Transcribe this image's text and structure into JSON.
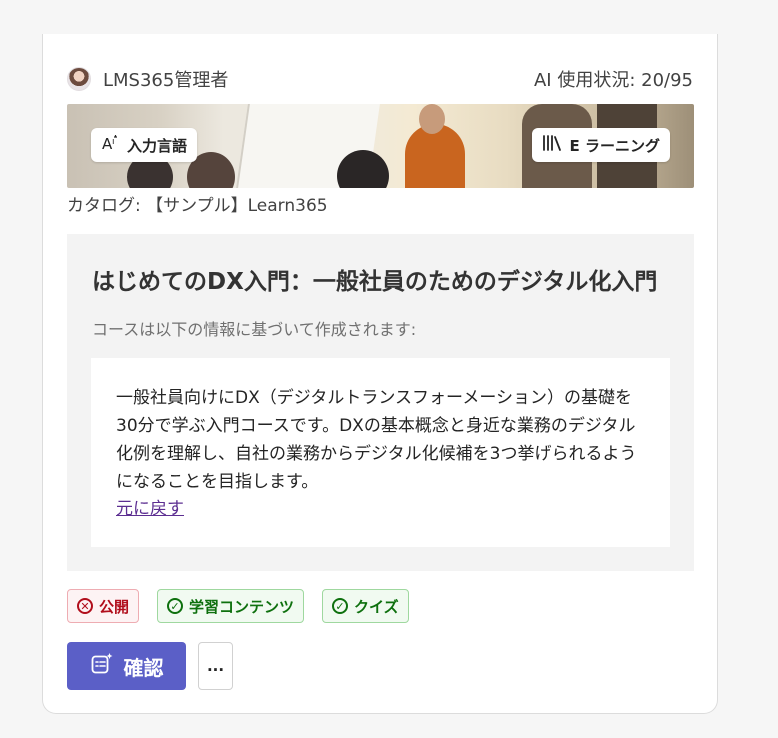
{
  "header": {
    "owner_name": "LMS365管理者",
    "ai_usage": "AI 使用状況: 20/95"
  },
  "banner": {
    "input_language_label": "入力言語",
    "course_type_label": "E ラーニング",
    "input_language_icon": "translate-icon",
    "course_type_icon": "library-icon"
  },
  "catalog": "カタログ: 【サンプル】Learn365",
  "course": {
    "title": "はじめてのDX入門：一般社員のためのデジタル化入門",
    "basis_text": "コースは以下の情報に基づいて作成されます:",
    "description": "一般社員向けにDX（デジタルトランスフォーメーション）の基礎を30分で学ぶ入門コースです。DXの基本概念と身近な業務のデジタル化例を理解し、自社の業務からデジタル化候補を3つ挙げられるようになることを目指します。",
    "revert_link": "元に戻す"
  },
  "tags": [
    {
      "label": "公開",
      "status": "excluded",
      "icon": "x-circle-icon",
      "color": "#b10e1c"
    },
    {
      "label": "学習コンテンツ",
      "status": "included",
      "icon": "check-circle-icon",
      "color": "#0e700e"
    },
    {
      "label": "クイズ",
      "status": "included",
      "icon": "check-circle-icon",
      "color": "#0e700e"
    }
  ],
  "actions": {
    "confirm_label": "確認",
    "more_label": "...",
    "confirm_icon": "sparkle-list-icon"
  },
  "colors": {
    "primary": "#5b5fc7",
    "link": "#5c2e91",
    "info_bg": "#f3f3f3"
  }
}
